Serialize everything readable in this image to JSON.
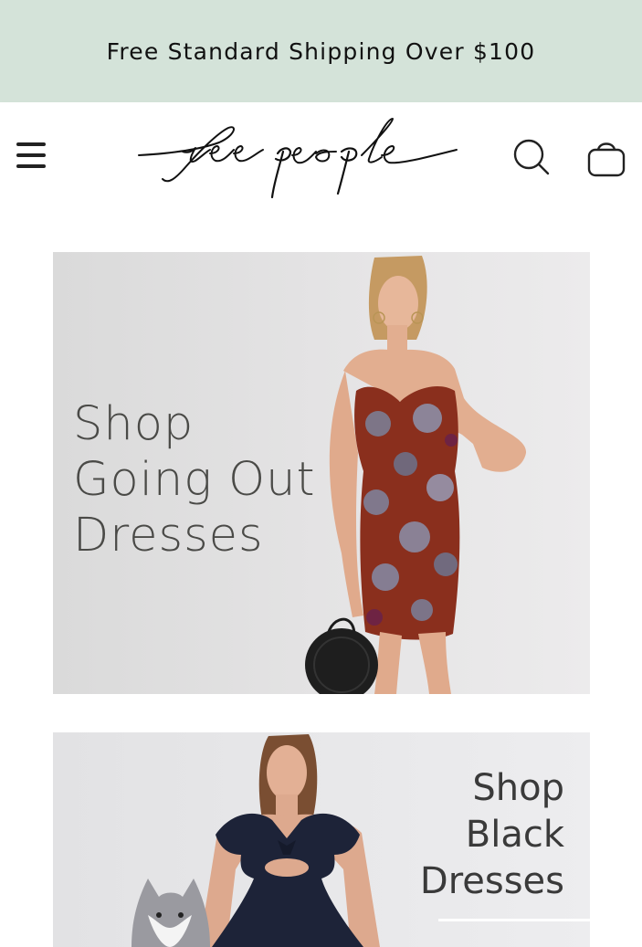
{
  "promo": {
    "text": "Free Standard Shipping Over $100",
    "background": "#d4e3d9"
  },
  "header": {
    "menu_icon": "hamburger-menu-icon",
    "logo_text": "free people",
    "search_icon": "search-icon",
    "bag_icon": "shopping-bag-icon"
  },
  "banners": [
    {
      "lines": [
        "Shop",
        "Going Out",
        "Dresses"
      ],
      "image_desc_icon": "model-floral-strapless-dress-image"
    },
    {
      "lines": [
        "Shop",
        "Black",
        "Dresses"
      ],
      "image_desc_icon": "model-navy-dress-with-husky-image"
    }
  ]
}
